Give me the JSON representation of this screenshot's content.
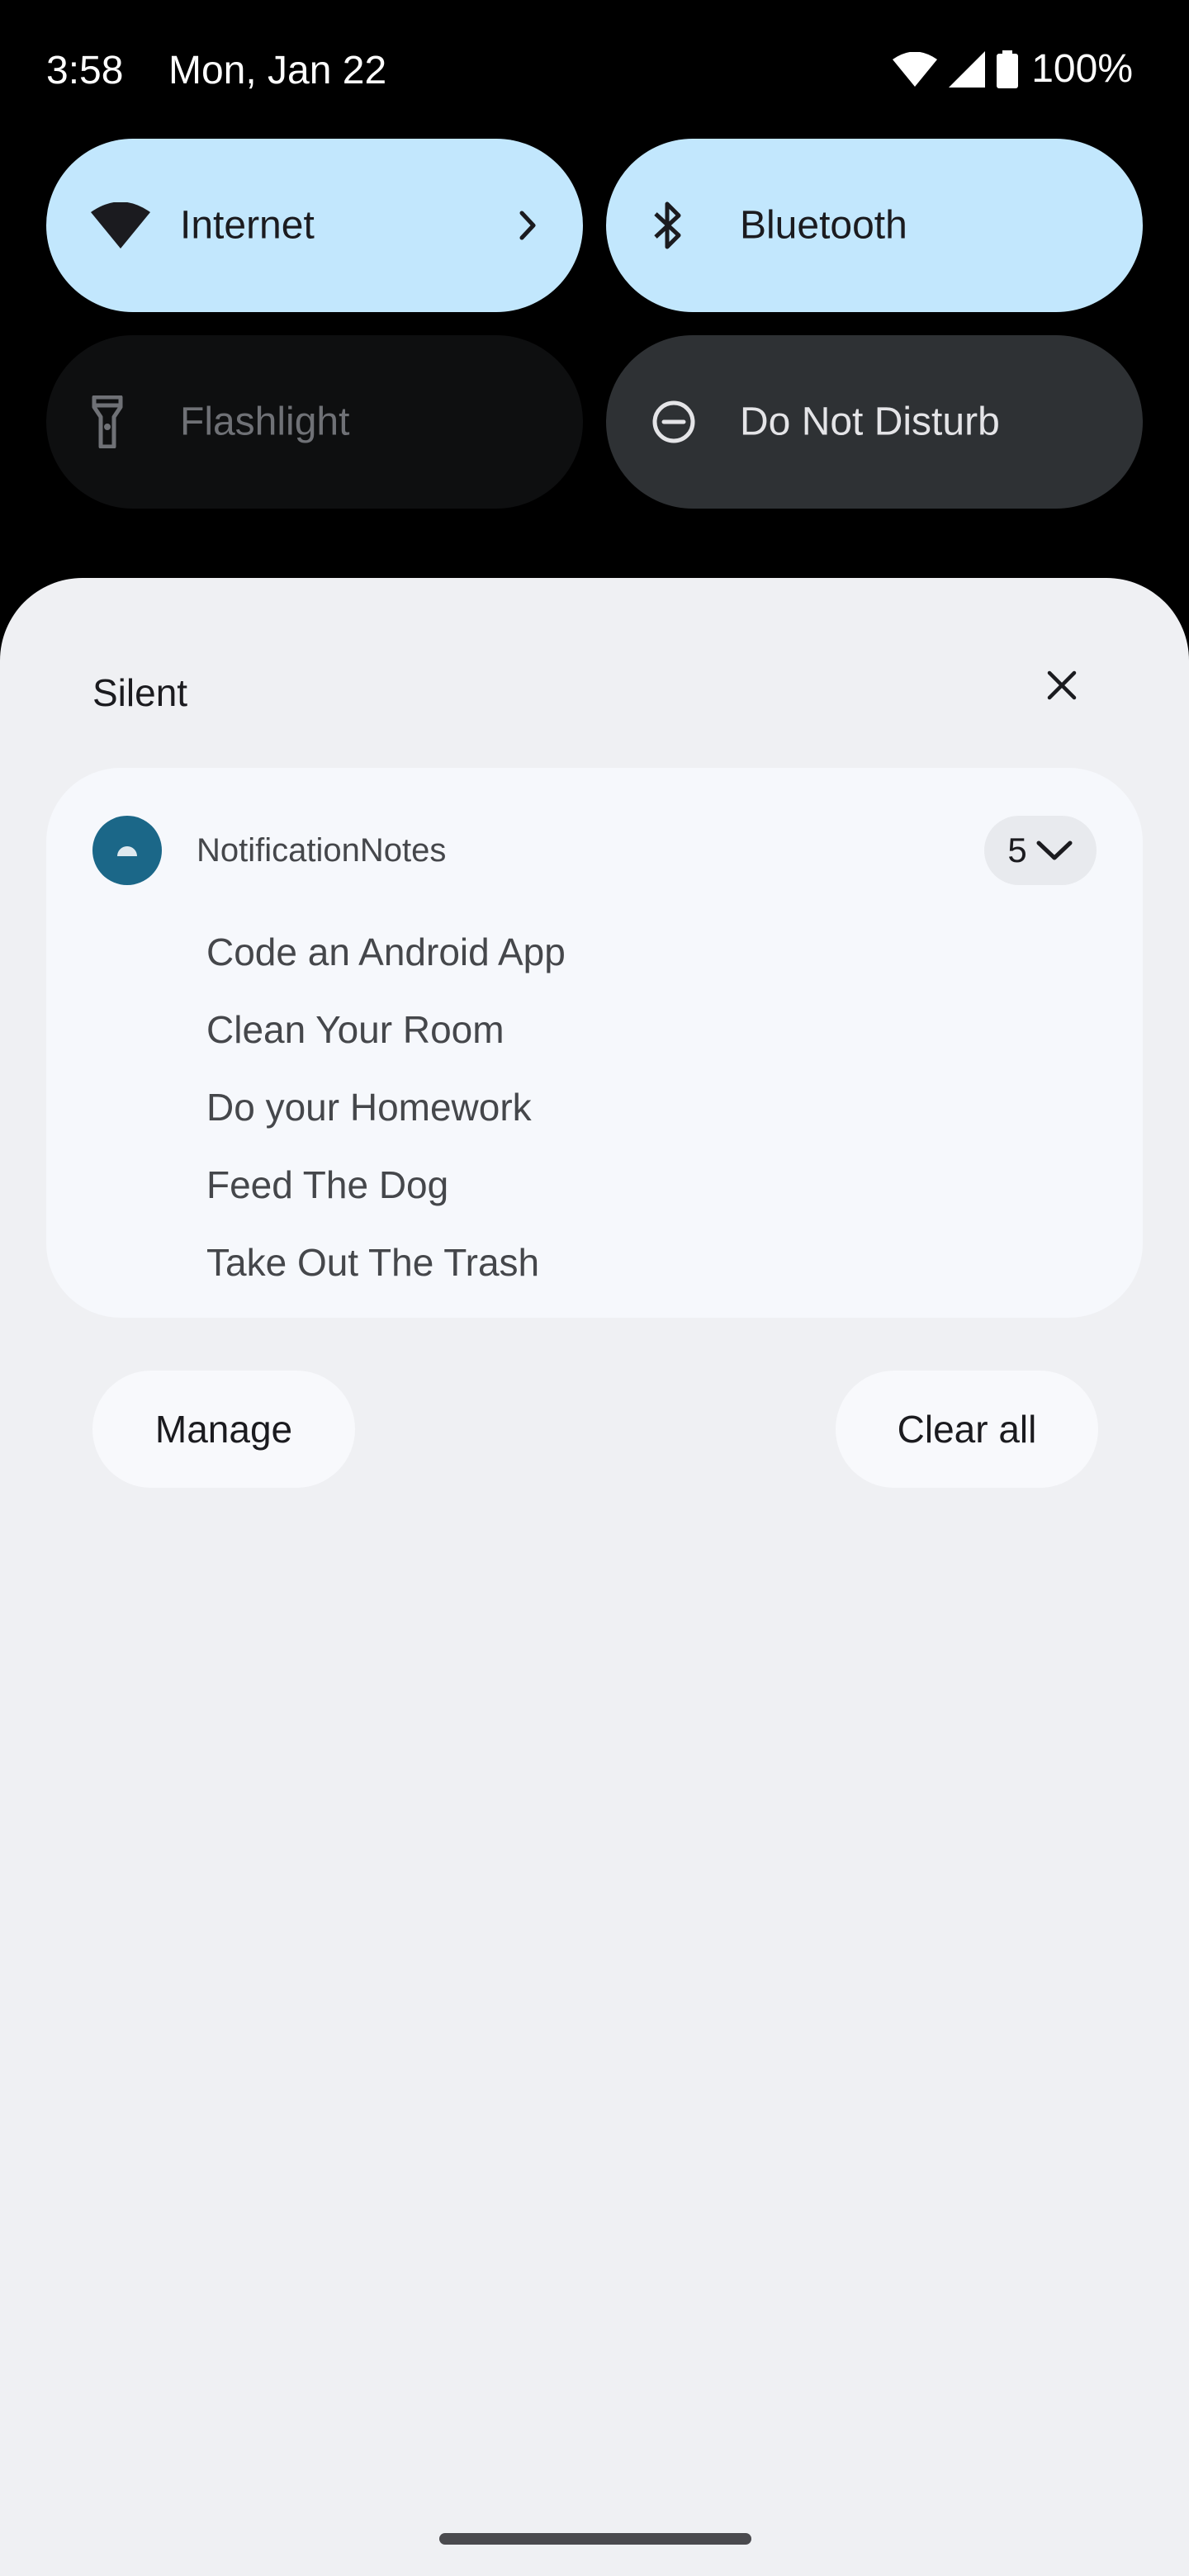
{
  "status_bar": {
    "time": "3:58",
    "date": "Mon, Jan 22",
    "battery": "100%",
    "icons": [
      "wifi-icon",
      "cell-signal-icon",
      "battery-icon"
    ]
  },
  "quick_settings": {
    "tiles": [
      {
        "label": "Internet",
        "icon": "wifi-icon",
        "state": "on"
      },
      {
        "label": "Bluetooth",
        "icon": "bluetooth-icon",
        "state": "on"
      },
      {
        "label": "Flashlight",
        "icon": "flashlight-icon",
        "state": "unavailable"
      },
      {
        "label": "Do Not Disturb",
        "icon": "do-not-disturb-icon",
        "state": "off"
      }
    ]
  },
  "shade": {
    "section_title": "Silent",
    "notification_group": {
      "app_name": "NotificationNotes",
      "count": "5",
      "items": [
        "Code an Android App",
        "Clean Your Room",
        "Do your Homework",
        "Feed The Dog",
        "Take Out The Trash"
      ]
    },
    "manage_label": "Manage",
    "clear_all_label": "Clear all"
  },
  "colors": {
    "tile_active": "#c2e7fd",
    "tile_inactive": "#2e3134",
    "tile_unavailable": "#0e0f10",
    "shade_bg": "#eff0f3",
    "card_bg": "#f6f8fc",
    "app_icon": "#1b6788"
  }
}
